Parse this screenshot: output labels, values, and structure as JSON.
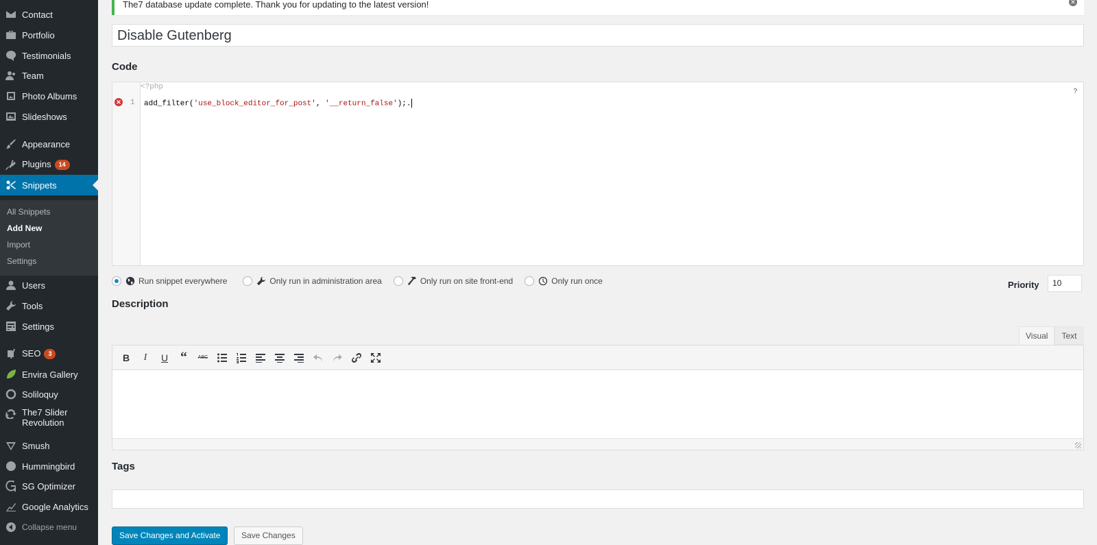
{
  "sidebar": {
    "items": [
      {
        "label": "Contact",
        "icon": "mail-icon"
      },
      {
        "label": "Portfolio",
        "icon": "portfolio-icon"
      },
      {
        "label": "Testimonials",
        "icon": "testimonial-icon"
      },
      {
        "label": "Team",
        "icon": "team-icon"
      },
      {
        "label": "Photo Albums",
        "icon": "photo-album-icon"
      },
      {
        "label": "Slideshows",
        "icon": "slideshow-icon"
      },
      {
        "label": "Appearance",
        "icon": "brush-icon"
      },
      {
        "label": "Plugins",
        "icon": "plugin-icon",
        "badge": "14"
      },
      {
        "label": "Snippets",
        "icon": "scissors-icon",
        "active": true
      },
      {
        "label": "Users",
        "icon": "user-icon"
      },
      {
        "label": "Tools",
        "icon": "wrench-icon"
      },
      {
        "label": "Settings",
        "icon": "settings-icon"
      },
      {
        "label": "SEO",
        "icon": "yoast-icon",
        "badge": "3"
      },
      {
        "label": "Envira Gallery",
        "icon": "leaf-icon"
      },
      {
        "label": "Soliloquy",
        "icon": "soliloquy-icon"
      },
      {
        "label": "The7 Slider Revolution",
        "icon": "refresh-icon"
      },
      {
        "label": "Smush",
        "icon": "smush-icon"
      },
      {
        "label": "Hummingbird",
        "icon": "hummingbird-icon"
      },
      {
        "label": "SG Optimizer",
        "icon": "sg-icon"
      },
      {
        "label": "Google Analytics",
        "icon": "analytics-icon"
      },
      {
        "label": "Collapse menu",
        "icon": "collapse-icon"
      }
    ],
    "submenu": [
      "All Snippets",
      "Add New",
      "Import",
      "Settings"
    ]
  },
  "notice": {
    "text": "The7 database update complete. Thank you for updating to the latest version!"
  },
  "snippet": {
    "title": "Disable Gutenberg",
    "code_heading": "Code",
    "php_open": "<?php",
    "line_number": "1",
    "code_fn": "add_filter(",
    "code_arg1": "'use_block_editor_for_post'",
    "code_sep": ", ",
    "code_arg2": "'__return_false'",
    "code_end": ");.",
    "help": "?"
  },
  "scope": {
    "options": [
      "Run snippet everywhere",
      "Only run in administration area",
      "Only run on site front-end",
      "Only run once"
    ],
    "selected": 0
  },
  "priority": {
    "label": "Priority",
    "value": "10"
  },
  "description": {
    "heading": "Description",
    "tab_visual": "Visual",
    "tab_text": "Text"
  },
  "tags": {
    "heading": "Tags"
  },
  "buttons": {
    "activate": "Save Changes and Activate",
    "save": "Save Changes"
  },
  "colors": {
    "sidebar_bg": "#23282d",
    "accent": "#0073aa",
    "notice_border": "#46b450",
    "badge": "#ca4a1f"
  }
}
